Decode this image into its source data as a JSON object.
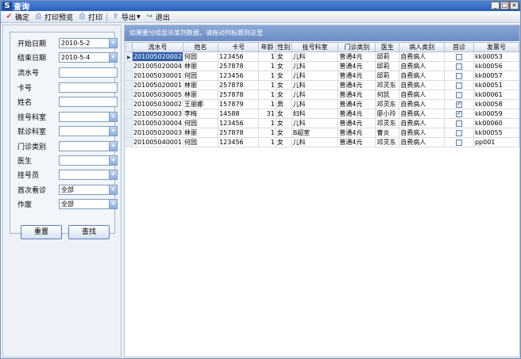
{
  "window": {
    "title": "查询",
    "app_icon": "S"
  },
  "toolbar": [
    {
      "name": "confirm",
      "label": "确定",
      "icon": "check-icon",
      "color": "#d0302a"
    },
    {
      "name": "print-preview",
      "label": "打印预览",
      "icon": "print-preview-icon",
      "color": "#3a64a8"
    },
    {
      "name": "print",
      "label": "打印",
      "icon": "printer-icon",
      "color": "#3a64a8"
    },
    {
      "name": "export",
      "label": "导出",
      "icon": "export-icon",
      "color": "#3a64a8"
    },
    {
      "name": "exit",
      "label": "退出",
      "icon": "exit-icon",
      "color": "#2e8b3a"
    }
  ],
  "filters": [
    {
      "key": "start_date",
      "label": "开始日期",
      "value": "2010-5-2",
      "dropdown": true
    },
    {
      "key": "end_date",
      "label": "结束日期",
      "value": "2010-5-4",
      "dropdown": true
    },
    {
      "key": "serial_no",
      "label": "流水号",
      "value": "",
      "dropdown": false
    },
    {
      "key": "card_no",
      "label": "卡号",
      "value": "",
      "dropdown": false
    },
    {
      "key": "name",
      "label": "姓名",
      "value": "",
      "dropdown": false
    },
    {
      "key": "reg_dept",
      "label": "挂号科室",
      "value": "",
      "dropdown": true
    },
    {
      "key": "visit_dept",
      "label": "就诊科室",
      "value": "",
      "dropdown": true
    },
    {
      "key": "clinic_type",
      "label": "门诊类别",
      "value": "",
      "dropdown": true
    },
    {
      "key": "doctor",
      "label": "医生",
      "value": "",
      "dropdown": true
    },
    {
      "key": "registrar",
      "label": "挂号员",
      "value": "",
      "dropdown": true
    },
    {
      "key": "first_visit",
      "label": "首次看诊",
      "value": "全部",
      "dropdown": true
    },
    {
      "key": "void",
      "label": "作废",
      "value": "全部",
      "dropdown": true
    }
  ],
  "buttons": {
    "reset": "重置",
    "search": "查找"
  },
  "grid": {
    "group_hint": "如果要分组显示某列数据，请拖动列标题到这里",
    "columns": [
      "流水号",
      "姓名",
      "卡号",
      "年龄",
      "性别",
      "挂号科室",
      "门诊类别",
      "医生",
      "病人类别",
      "首诊",
      "发票号"
    ],
    "rows": [
      {
        "lsh": "201005020002",
        "name": "何园",
        "card": "123456",
        "age": "1",
        "sex": "女",
        "dept": "儿科",
        "type": "普通4元",
        "doctor": "邱莉",
        "ptype": "自费病人",
        "first": false,
        "invoice": "kk00053",
        "selected": true
      },
      {
        "lsh": "201005020004",
        "name": "林丽",
        "card": "257878",
        "age": "1",
        "sex": "女",
        "dept": "儿科",
        "type": "普通4元",
        "doctor": "邱莉",
        "ptype": "自费病人",
        "first": false,
        "invoice": "kk00056",
        "selected": false
      },
      {
        "lsh": "201005030001",
        "name": "何园",
        "card": "123456",
        "age": "1",
        "sex": "女",
        "dept": "儿科",
        "type": "普通4元",
        "doctor": "邱莉",
        "ptype": "自费病人",
        "first": false,
        "invoice": "kk00057",
        "selected": false
      },
      {
        "lsh": "201005020001",
        "name": "林丽",
        "card": "257878",
        "age": "1",
        "sex": "女",
        "dept": "儿科",
        "type": "普通4元",
        "doctor": "邓灵东",
        "ptype": "自费病人",
        "first": false,
        "invoice": "kk00051",
        "selected": false
      },
      {
        "lsh": "201005030005",
        "name": "林丽",
        "card": "257878",
        "age": "1",
        "sex": "女",
        "dept": "儿科",
        "type": "普通4元",
        "doctor": "何凯",
        "ptype": "自费病人",
        "first": false,
        "invoice": "kk00061",
        "selected": false
      },
      {
        "lsh": "201005030002",
        "name": "王丽娜",
        "card": "157879",
        "age": "1",
        "sex": "男",
        "dept": "儿科",
        "type": "普通4元",
        "doctor": "邓灵东",
        "ptype": "自费病人",
        "first": true,
        "invoice": "kk00058",
        "selected": false
      },
      {
        "lsh": "201005030003",
        "name": "李梅",
        "card": "14588",
        "age": "31",
        "sex": "女",
        "dept": "妇科",
        "type": "普通4元",
        "doctor": "廖小玲",
        "ptype": "自费病人",
        "first": true,
        "invoice": "kk00059",
        "selected": false
      },
      {
        "lsh": "201005030004",
        "name": "何园",
        "card": "123456",
        "age": "1",
        "sex": "女",
        "dept": "儿科",
        "type": "普通4元",
        "doctor": "邓灵东",
        "ptype": "自费病人",
        "first": false,
        "invoice": "kk00060",
        "selected": false
      },
      {
        "lsh": "201005020003",
        "name": "林丽",
        "card": "257878",
        "age": "1",
        "sex": "女",
        "dept": "B超室",
        "type": "普通4元",
        "doctor": "曹炎",
        "ptype": "自费病人",
        "first": false,
        "invoice": "kk00055",
        "selected": false
      },
      {
        "lsh": "201005040001",
        "name": "何园",
        "card": "123456",
        "age": "1",
        "sex": "女",
        "dept": "儿科",
        "type": "普通4元",
        "doctor": "邓灵东",
        "ptype": "自费病人",
        "first": false,
        "invoice": "pp001",
        "selected": false
      }
    ]
  }
}
